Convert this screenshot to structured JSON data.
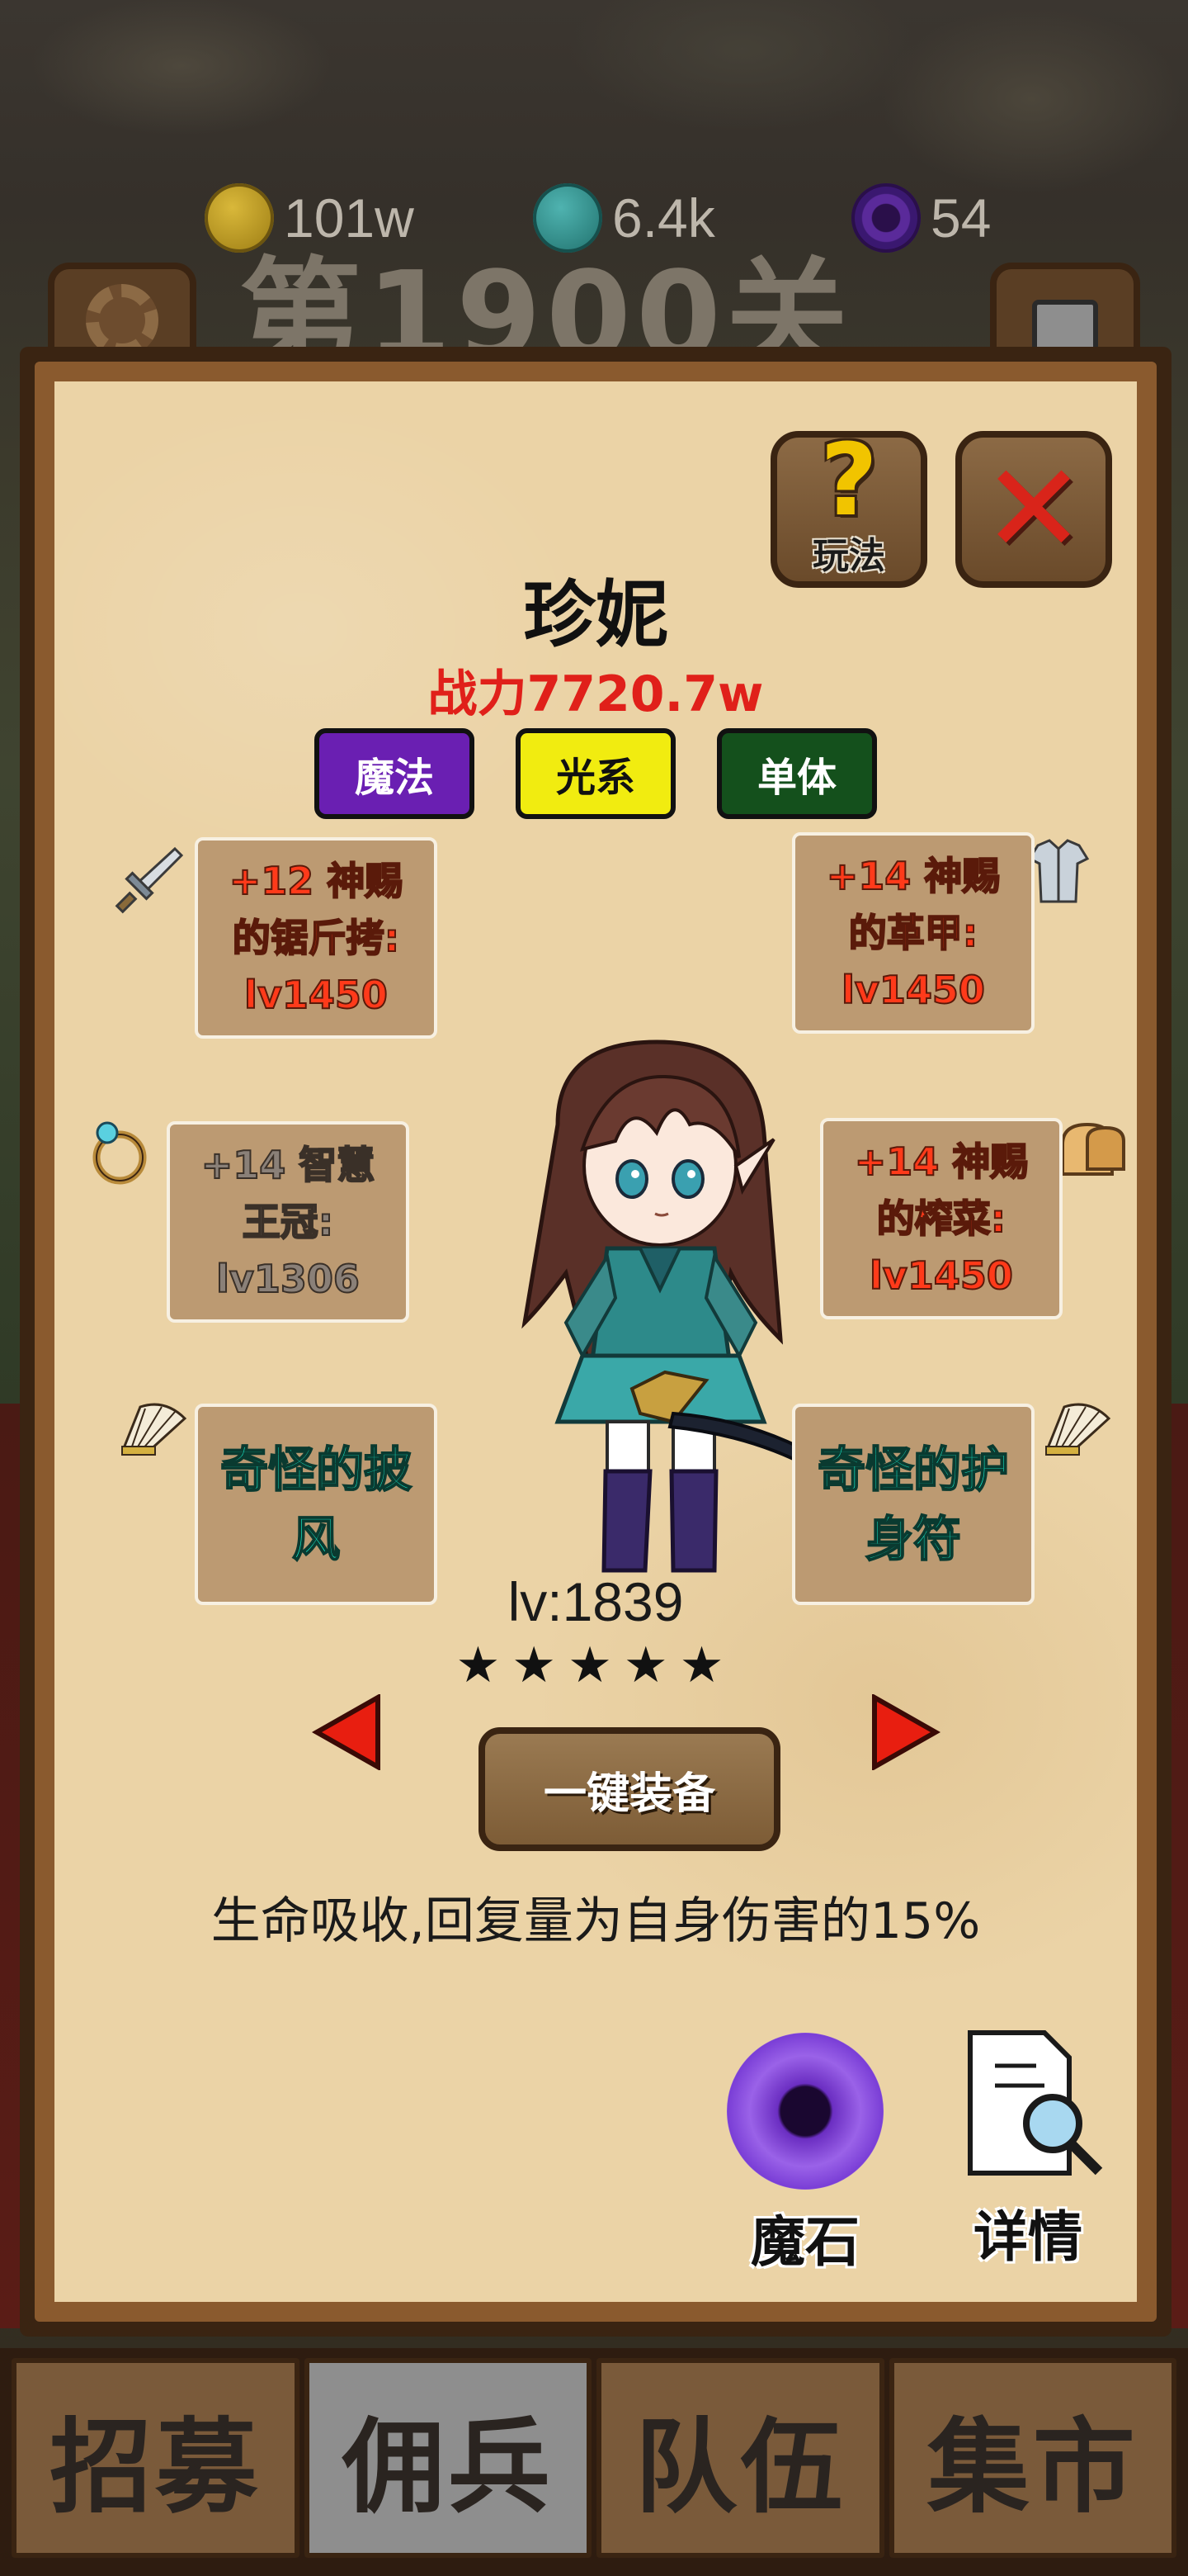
{
  "currency": {
    "gold": "101w",
    "gems": "6.4k",
    "magic_stones": "54"
  },
  "header": {
    "level_title": "第1900关"
  },
  "hero": {
    "name": "珍妮",
    "power": "战力7720.7w",
    "tags": [
      "魔法",
      "光系",
      "单体"
    ],
    "level": "lv:1839",
    "stars": "★★★★★",
    "skill_description": "生命吸收,回复量为自身伤害的15%"
  },
  "buttons": {
    "help_label": "玩法",
    "equip_all_label": "一键装备",
    "magic_stone_label": "魔石",
    "details_label": "详情"
  },
  "equipment": {
    "weapon": "+12 神赐\n的锯斤拷:\nlv1450",
    "armor": "+14 神赐\n的革甲:\nlv1450",
    "ring": "+14 智慧\n王冠:\nlv1306",
    "food": "+14 神赐\n的榨菜:\nlv1450",
    "cape": "奇怪的披\n风",
    "amulet": "奇怪的护\n身符"
  },
  "tabs": [
    "招募",
    "佣兵",
    "队伍",
    "集市"
  ],
  "active_tab": "佣兵",
  "colors": {
    "power": "#e0201a",
    "tag_magic": "#6a1fb2",
    "tag_light": "#f1ec10",
    "tag_single": "#14501c",
    "equip_enhanced": "#ff3a1a",
    "equip_weird": "#1af0cf",
    "parchment": "#ebd3a6"
  }
}
